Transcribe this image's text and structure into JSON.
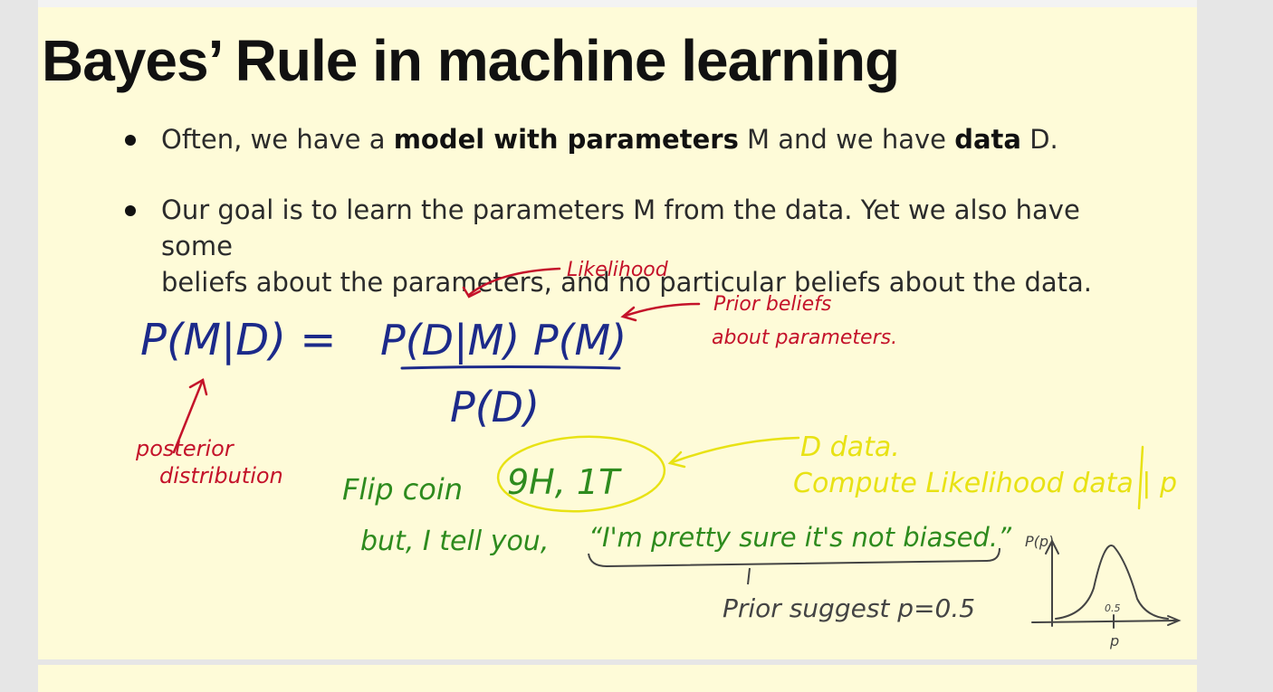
{
  "slide": {
    "title": "Bayes’ Rule in machine learning",
    "bullets": [
      {
        "t1": "Often, we have a ",
        "b1": "model with parameters",
        "t2": " M and we have ",
        "b2": "data",
        "t3": " D."
      },
      {
        "line1": "Our goal is to learn the parameters M from the data. Yet we also have some",
        "line2": "beliefs about the parameters, and no particular beliefs about the data."
      }
    ]
  },
  "annotations": {
    "likelihood": "Likelihood",
    "prior_line1": "Prior beliefs",
    "prior_line2": "about parameters.",
    "posterior_line1": "posterior",
    "posterior_line2": "distribution",
    "eq_lhs": "P(M|D) =",
    "eq_numerator": "P(D|M) P(M)",
    "eq_denominator": "P(D)",
    "flip_coin": "Flip coin",
    "coin_data": "9H, 1T",
    "d_data": "D  data.",
    "compute": "Compute Likelihood data | p",
    "but_tell": "but, I tell you,",
    "quote": "“I'm pretty sure it's not biased.”",
    "prior_suggest": "Prior suggest  p=0.5",
    "plot_ylabel": "P(p)",
    "plot_tick": "0.5",
    "plot_xlabel": "p"
  },
  "colors": {
    "slide_bg": "#fefbd8",
    "ink_blue": "#1c2a8a",
    "ink_red": "#c4122a",
    "ink_yellow": "#e8e214",
    "ink_green": "#2e8b1e",
    "ink_dark": "#444444"
  }
}
